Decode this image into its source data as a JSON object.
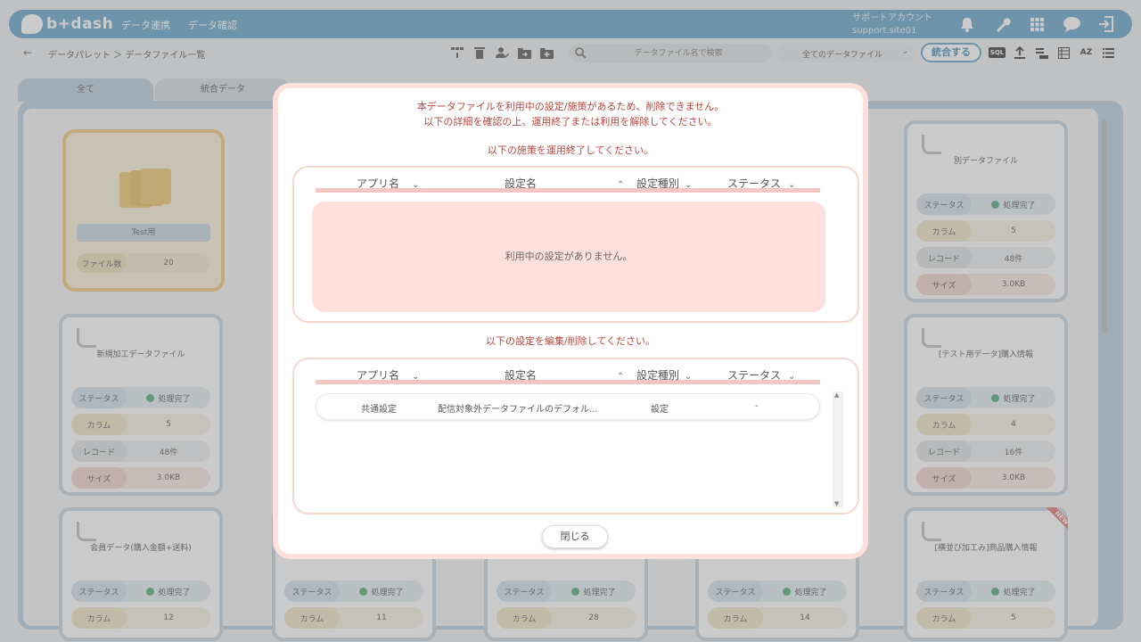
{
  "header": {
    "logo_text": "b+dash",
    "nav": [
      "データ連携",
      "データ確認"
    ],
    "account_label": "サポートアカウント",
    "account_site": "support.site01",
    "icons": [
      "bell-icon",
      "wrench-icon",
      "grid-icon",
      "chat-icon",
      "logout-icon"
    ]
  },
  "toolbar": {
    "breadcrumb": "データパレット ＞ データファイル一覧",
    "search_placeholder": "データファイル名で検索",
    "filter_value": "全てのデータファイル",
    "merge_label": "統合する",
    "sql_label": "SQL",
    "az_label": "AZ"
  },
  "tabs": [
    "全て",
    "統合データ"
  ],
  "folder": {
    "name": "Test用",
    "file_count_label": "ファイル数",
    "file_count": "20"
  },
  "labels": {
    "status": "ステータス",
    "column": "カラム",
    "record": "レコード",
    "size": "サイズ",
    "done": "処理完了",
    "new": "NEW"
  },
  "cards": [
    {
      "title": "新規加工データファイル",
      "columns": "5",
      "records": "48件",
      "size": "3.0KB"
    },
    {
      "title": "会員データ(購入金額+送料)",
      "columns": "12"
    },
    {
      "title": "",
      "columns": "11"
    },
    {
      "title": "",
      "columns": "28"
    },
    {
      "title": "",
      "columns": "14"
    },
    {
      "title": "別データファイル",
      "columns": "5",
      "records": "48件",
      "size": "3.0KB"
    },
    {
      "title": "[テスト用データ]購入情報",
      "columns": "4",
      "records": "16件",
      "size": "3.0KB"
    },
    {
      "title": "[横並び加工み]商品購入情報",
      "columns": "5"
    }
  ],
  "modal": {
    "message_line1": "本データファイルを利用中の設定/施策があるため、削除できません。",
    "message_line2": "以下の詳細を確認の上、運用終了または利用を解除してください。",
    "section1_title": "以下の施策を運用終了してください。",
    "section2_title": "以下の設定を編集/削除してください。",
    "columns": {
      "app": "アプリ名",
      "setting": "設定名",
      "type": "設定種別",
      "status": "ステータス"
    },
    "empty_message": "利用中の設定がありません。",
    "rows": [
      {
        "app": "共通設定",
        "setting": "配信対象外データファイルのデフォル...",
        "type": "設定",
        "status": "-"
      }
    ],
    "close_label": "閉じる"
  }
}
